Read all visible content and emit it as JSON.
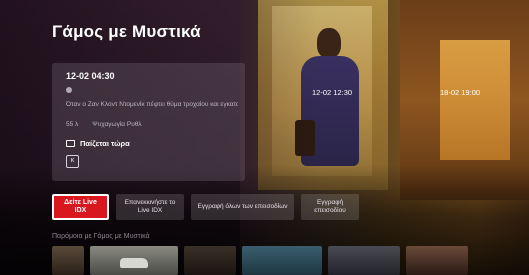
{
  "program": {
    "title": "Γάμος με Μυστικά"
  },
  "info": {
    "datetime": "12-02 04:30",
    "description": "Όταν ο Ζαν Κλοντ Ντομενίκ πέφτει θύμα τροχαίου και εγκαταλείπεται, η γυναίκα του...",
    "duration": "55 λ",
    "genre": "Ψυχαγωγία Ρυθλ",
    "now_playing": "Παίζεται τώρα",
    "rating_icon": "rating-icon"
  },
  "timeline": {
    "marker_1": "12-02 12:30",
    "marker_2": "18-02 19:00"
  },
  "actions": {
    "watch_live": "Δείτε Live IDX",
    "restart": "Επανεκκινήστε το Live IDX",
    "record_all": "Εγγραφή όλων των επεισοδίων",
    "record_one": "Εγγραφή επεισοδίου"
  },
  "similar": {
    "label": "Παρόμοια με Γάμος με Μυστικά"
  },
  "colors": {
    "accent_red": "#d8171f"
  }
}
